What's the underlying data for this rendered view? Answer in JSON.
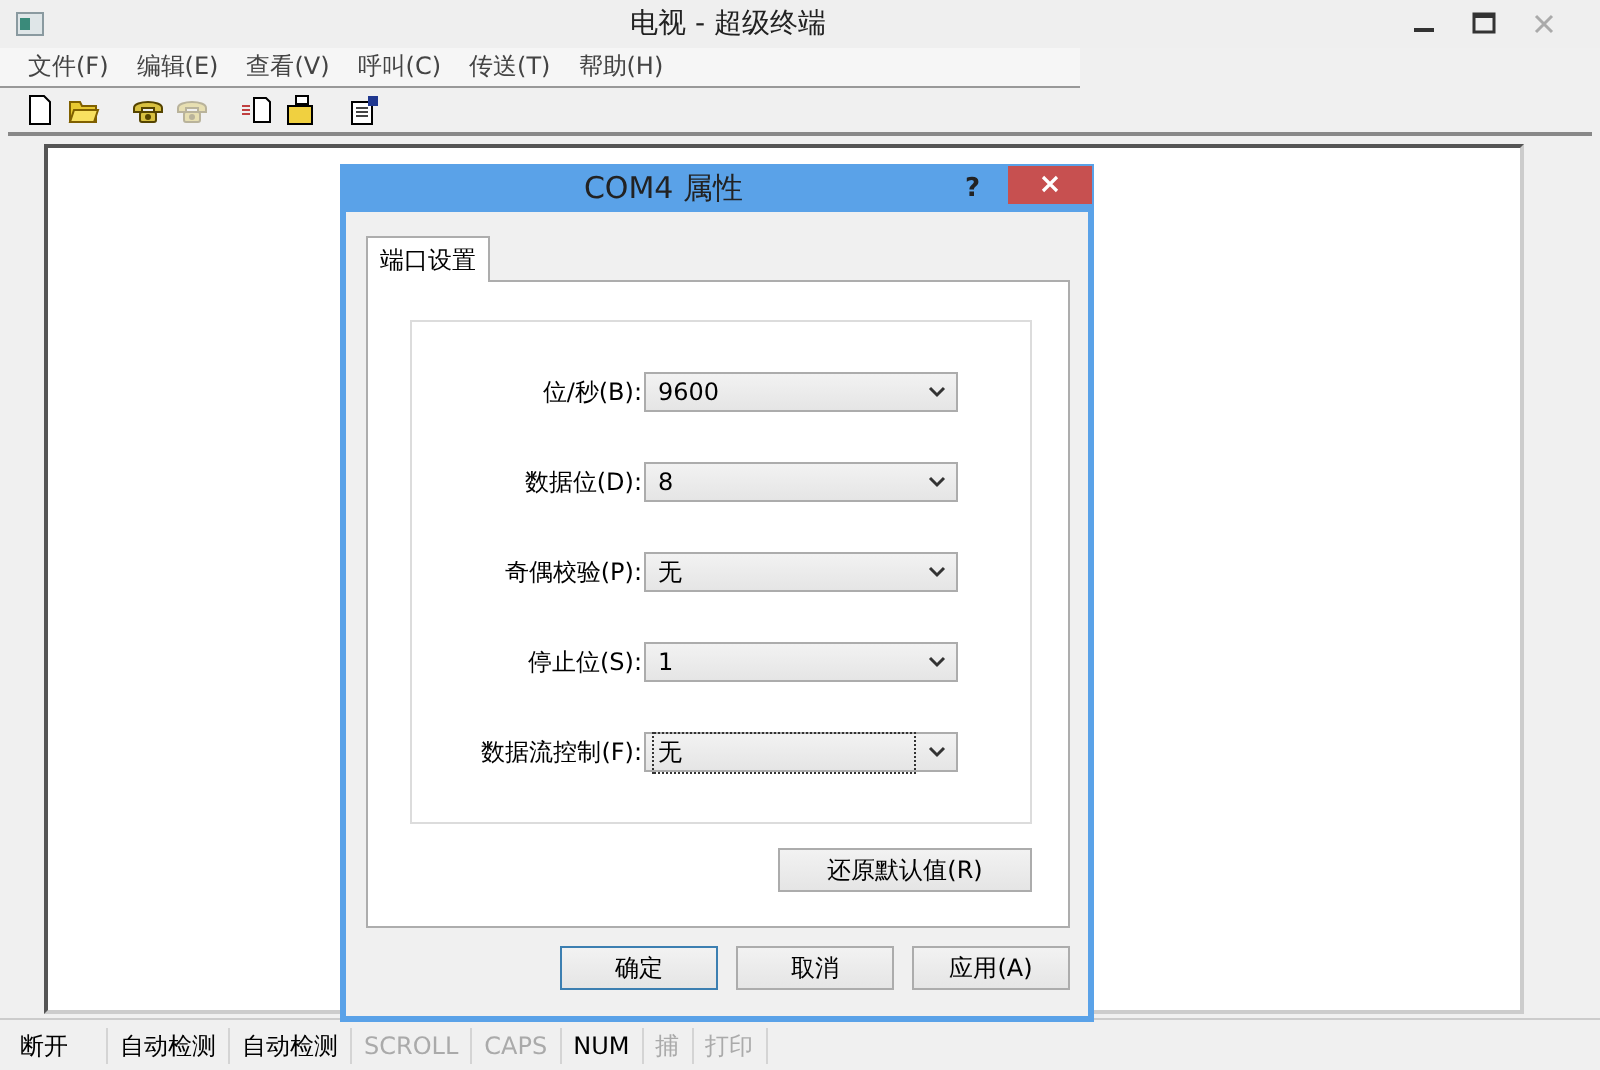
{
  "window": {
    "title": "电视 - 超级终端"
  },
  "menu": [
    {
      "label": "文件(F)"
    },
    {
      "label": "编辑(E)"
    },
    {
      "label": "查看(V)"
    },
    {
      "label": "呼叫(C)"
    },
    {
      "label": "传送(T)"
    },
    {
      "label": "帮助(H)"
    }
  ],
  "toolbar": [
    {
      "kind": "new",
      "disabled": false
    },
    {
      "kind": "open",
      "disabled": false
    },
    {
      "kind": "phone",
      "disabled": false
    },
    {
      "kind": "phone",
      "disabled": true
    },
    {
      "kind": "send",
      "disabled": false
    },
    {
      "kind": "receive",
      "disabled": false
    },
    {
      "kind": "properties",
      "disabled": false
    }
  ],
  "dialog": {
    "title": "COM4 属性",
    "help": "?",
    "tabs": [
      {
        "label": "端口设置",
        "selected": true
      }
    ],
    "fields": [
      {
        "label": "位/秒(B):",
        "value": "9600",
        "focused": false
      },
      {
        "label": "数据位(D):",
        "value": "8",
        "focused": false
      },
      {
        "label": "奇偶校验(P):",
        "value": "无",
        "focused": false
      },
      {
        "label": "停止位(S):",
        "value": "1",
        "focused": false
      },
      {
        "label": "数据流控制(F):",
        "value": "无",
        "focused": true
      }
    ],
    "restore_button": "还原默认值(R)",
    "buttons": [
      {
        "label": "确定",
        "default": true
      },
      {
        "label": "取消",
        "default": false
      },
      {
        "label": "应用(A)",
        "default": false
      }
    ]
  },
  "status_bar": [
    {
      "text": "断开",
      "disabled": false
    },
    {
      "text": "自动检测",
      "disabled": false
    },
    {
      "text": "自动检测",
      "disabled": false
    },
    {
      "text": "SCROLL",
      "disabled": true
    },
    {
      "text": "CAPS",
      "disabled": true
    },
    {
      "text": "NUM",
      "disabled": false
    },
    {
      "text": "捕",
      "disabled": true
    },
    {
      "text": "打印",
      "disabled": true
    }
  ]
}
